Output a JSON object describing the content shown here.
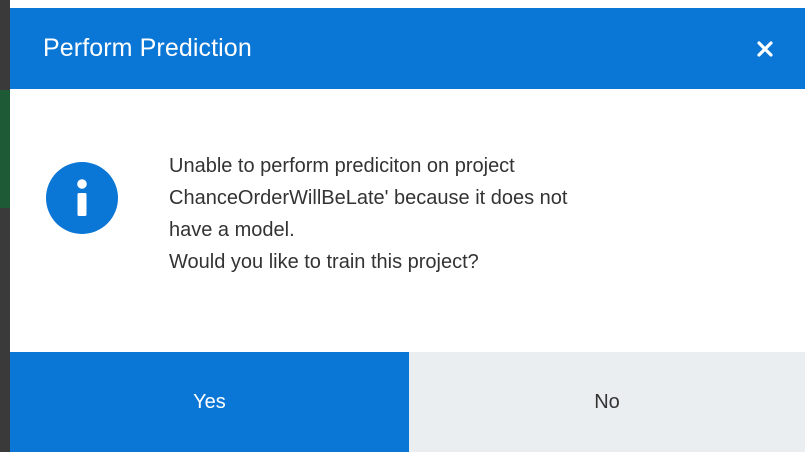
{
  "dialog": {
    "title": "Perform Prediction",
    "close_icon": "close-icon",
    "info_icon": "info-icon",
    "message_lines": [
      "Unable to perform prediciton on project",
      "ChanceOrderWillBeLate' because it does not",
      "have a model.",
      "Would you like to train this project?"
    ],
    "yes_label": "Yes",
    "no_label": "No"
  },
  "colors": {
    "header": "#0a76d6",
    "yes_button": "#0a76d6",
    "no_button": "#ebeef0",
    "text": "#333333",
    "icon": "#0a76d6"
  }
}
